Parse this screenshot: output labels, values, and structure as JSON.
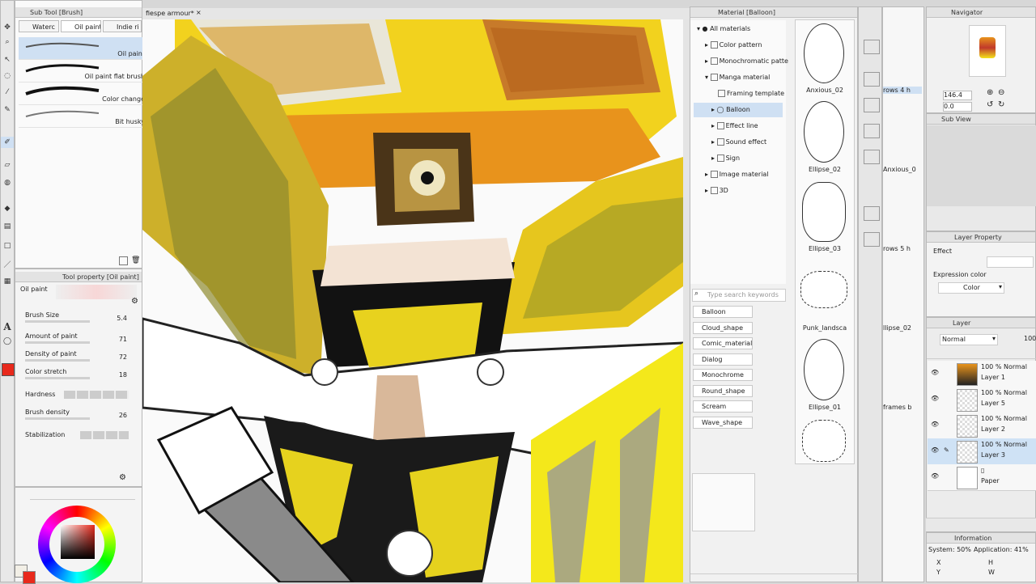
{
  "document_tab": "fiespe armour*",
  "sub_tool": {
    "title": "Sub Tool [Brush]",
    "tabs": [
      "Waterc",
      "Oil paint",
      "Indie ri"
    ],
    "brushes": [
      "Oil paint",
      "Oil paint flat brush",
      "Color change",
      "Bit husky"
    ]
  },
  "tool_property": {
    "title": "Tool property [Oil paint]",
    "current": "Oil paint",
    "props": [
      {
        "name": "Brush Size",
        "value": "5.4"
      },
      {
        "name": "Amount of paint",
        "value": "71"
      },
      {
        "name": "Density of paint",
        "value": "72"
      },
      {
        "name": "Color stretch",
        "value": "18"
      },
      {
        "name": "Hardness",
        "value": ""
      },
      {
        "name": "Brush density",
        "value": "26"
      },
      {
        "name": "Stabilization",
        "value": ""
      }
    ]
  },
  "colors": {
    "main": "#e8291c",
    "sub": "#f2efe6",
    "accent": "#f4e21b"
  },
  "material": {
    "title": "Material [Balloon]",
    "tree": [
      "All materials",
      "Color pattern",
      "Monochromatic patte",
      "Manga material",
      "Framing template",
      "Balloon",
      "Effect line",
      "Sound effect",
      "Sign",
      "Image material",
      "3D"
    ],
    "search_placeholder": "Type search keywords",
    "tags": [
      "Balloon",
      "Cloud_shape",
      "Comic_material",
      "Dialog",
      "Monochrome",
      "Round_shape",
      "Scream",
      "Wave_shape"
    ],
    "thumbs": [
      "Anxious_02",
      "Ellipse_02",
      "Ellipse_03",
      "Punk_landsca",
      "Ellipse_01"
    ]
  },
  "side_partial_labels": [
    "rows 4 h",
    "Anxious_0",
    "rows 5 h",
    "llipse_02",
    "frames b"
  ],
  "navigator": {
    "title": "Navigator",
    "zoom": "146.4",
    "rotation": "0.0",
    "sub_view": "Sub View"
  },
  "layer_property": {
    "title": "Layer Property",
    "effect": "Effect",
    "expression_label": "Expression color",
    "expression_value": "Color"
  },
  "layer_panel": {
    "title": "Layer",
    "blend": "Normal",
    "opacity": "100",
    "layers": [
      {
        "pct": "100 %",
        "mode": "Normal",
        "name": "Layer 1"
      },
      {
        "pct": "100 %",
        "mode": "Normal",
        "name": "Layer 5"
      },
      {
        "pct": "100 %",
        "mode": "Normal",
        "name": "Layer 2"
      },
      {
        "pct": "100 %",
        "mode": "Normal",
        "name": "Layer 3"
      },
      {
        "pct": "",
        "mode": "",
        "name": "Paper"
      }
    ]
  },
  "information": {
    "title": "Information",
    "system": "System: 50%",
    "application": "Application: 41%",
    "x": "X",
    "y": "Y",
    "h": "H",
    "w": "W"
  }
}
